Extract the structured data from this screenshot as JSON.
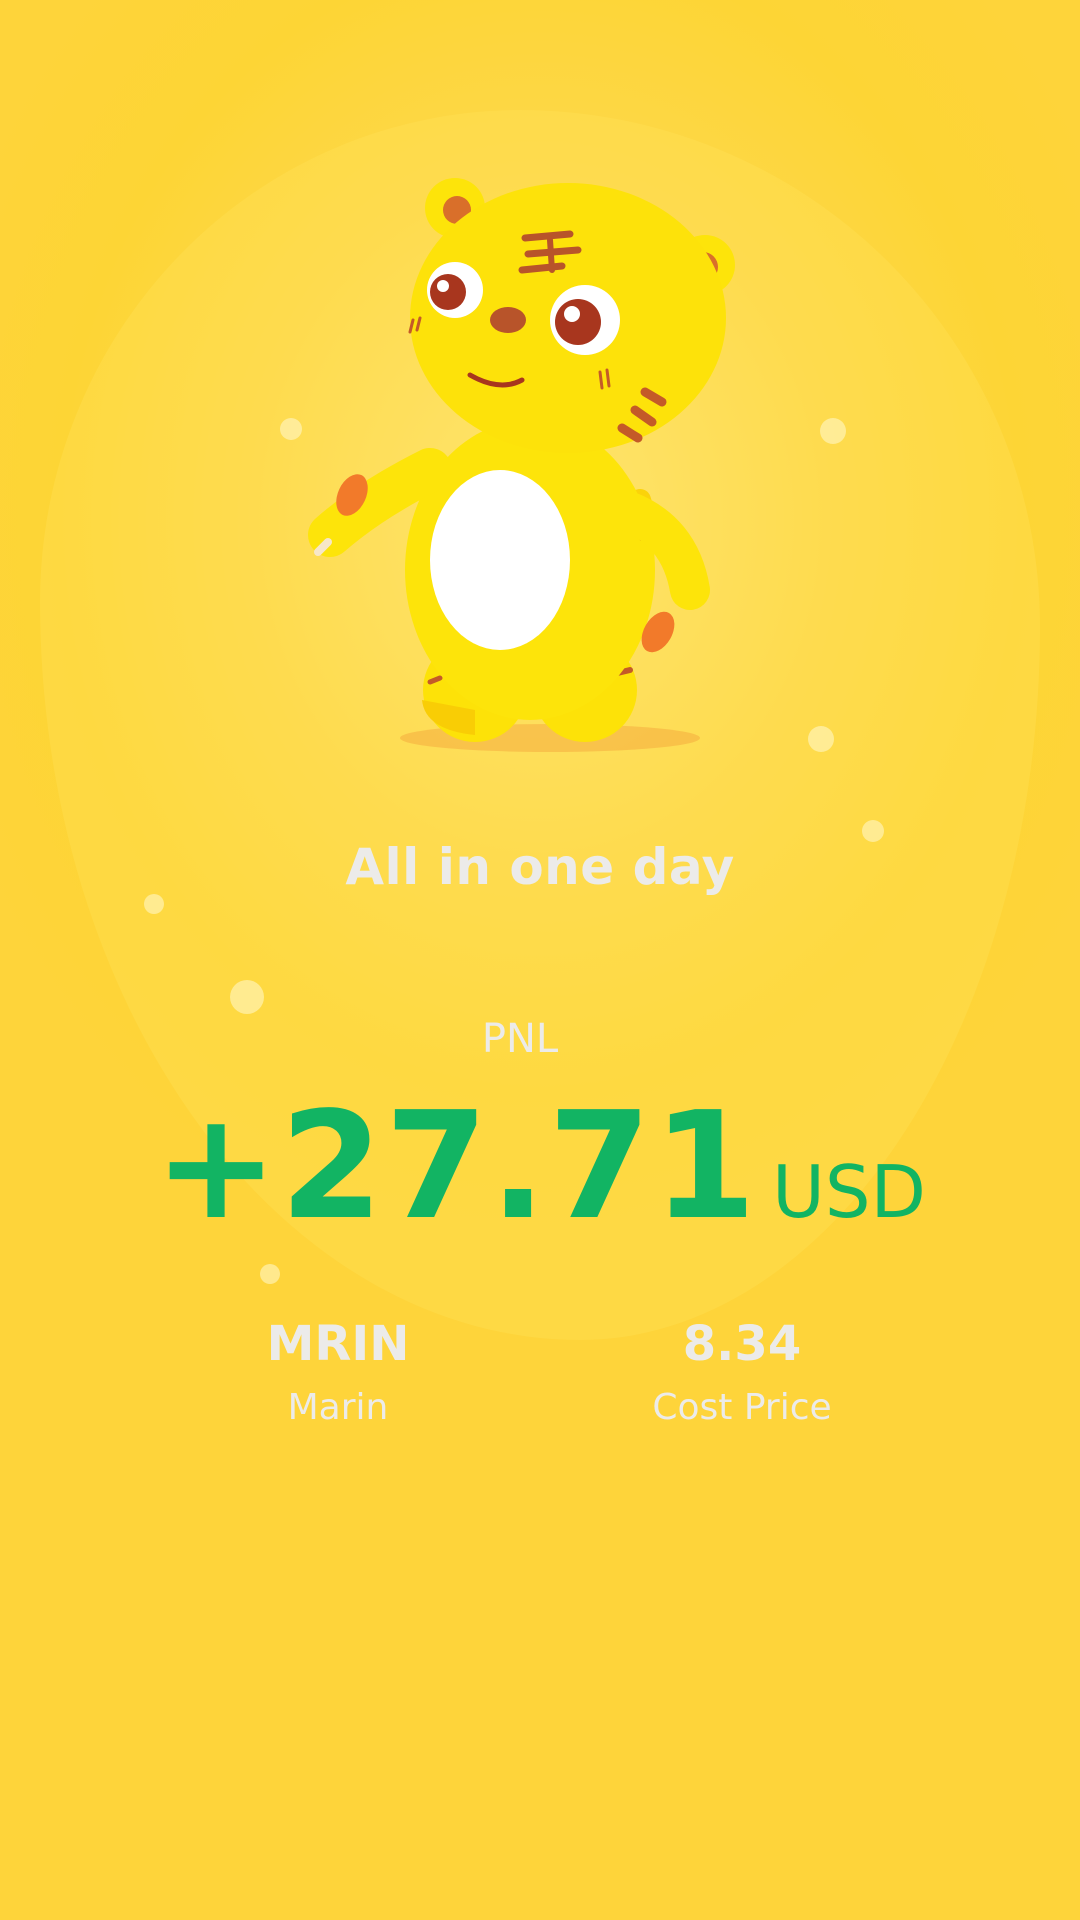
{
  "headline": "All in one day",
  "pnl": {
    "label": "PNL",
    "value": "+27.71",
    "unit": "USD",
    "color": "#12b463"
  },
  "stats": {
    "symbol": {
      "value": "MRIN",
      "label": "Marin"
    },
    "cost": {
      "value": "8.34",
      "label": "Cost Price"
    }
  },
  "colors": {
    "background": "#fdd535",
    "text_light": "#ecebe9",
    "mascot_body": "#fde80a"
  },
  "icons": {
    "mascot": "tiger-mascot-icon"
  }
}
